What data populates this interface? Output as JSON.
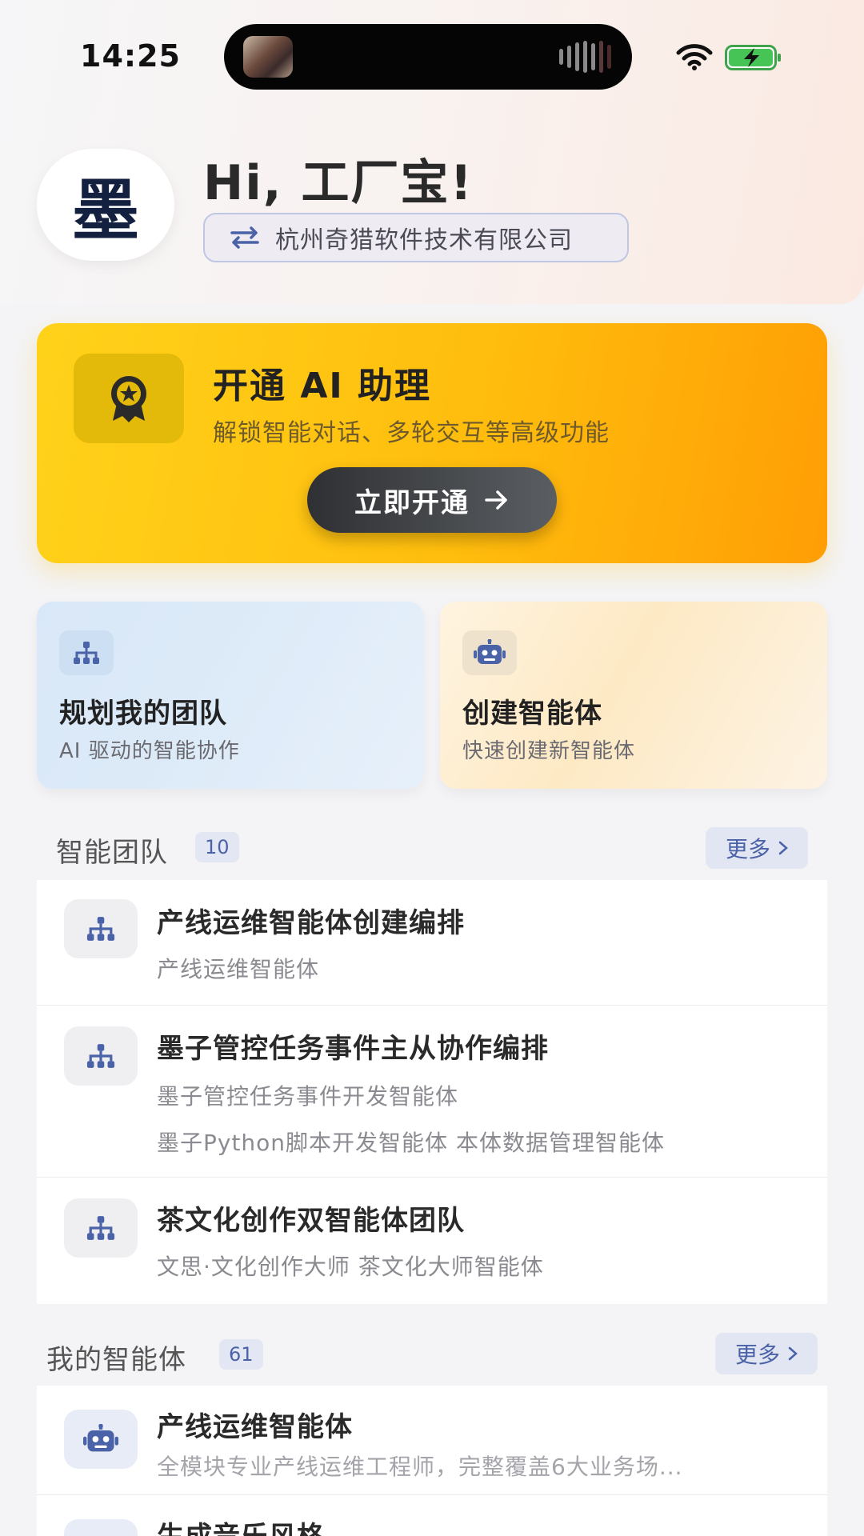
{
  "status_bar": {
    "time": "14:25"
  },
  "header": {
    "avatar_char": "墨",
    "greeting": "Hi, 工厂宝!",
    "company": "杭州奇猎软件技术有限公司"
  },
  "promo": {
    "title": "开通 AI 助理",
    "subtitle": "解锁智能对话、多轮交互等高级功能",
    "button_label": "立即开通"
  },
  "quick_actions": [
    {
      "title": "规划我的团队",
      "subtitle": "AI 驱动的智能协作",
      "icon": "team-org-icon"
    },
    {
      "title": "创建智能体",
      "subtitle": "快速创建新智能体",
      "icon": "robot-icon"
    }
  ],
  "teams_section": {
    "title": "智能团队",
    "count": "10",
    "more_label": "更多",
    "items": [
      {
        "title": "产线运维智能体创建编排",
        "lines": [
          "产线运维智能体"
        ]
      },
      {
        "title": "墨子管控任务事件主从协作编排",
        "lines": [
          "墨子管控任务事件开发智能体",
          "墨子Python脚本开发智能体 本体数据管理智能体"
        ]
      },
      {
        "title": "茶文化创作双智能体团队",
        "lines": [
          "文思·文化创作大师 茶文化大师智能体"
        ]
      }
    ]
  },
  "agents_section": {
    "title": "我的智能体",
    "count": "61",
    "more_label": "更多",
    "items": [
      {
        "title": "产线运维智能体",
        "desc": "全模块专业产线运维工程师，完整覆盖6大业务场..."
      },
      {
        "title": "生成音乐风格",
        "desc": ""
      }
    ]
  },
  "colors": {
    "accent": "#4a62a8",
    "promo_start": "#ffd21a",
    "promo_end": "#ff9e05"
  }
}
